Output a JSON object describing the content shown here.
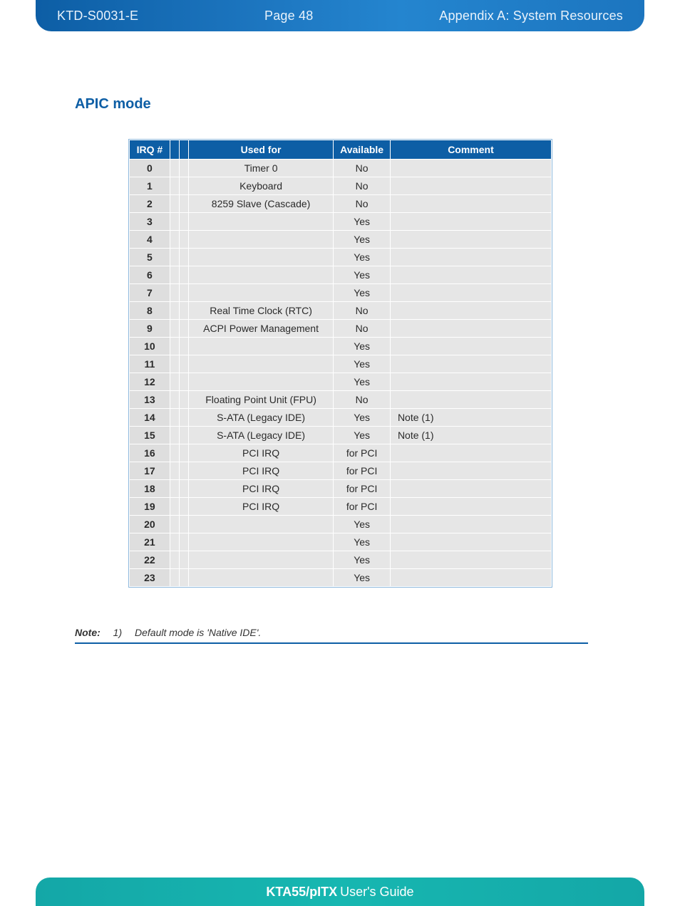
{
  "header": {
    "doc_id": "KTD-S0031-E",
    "page_label": "Page 48",
    "section": "Appendix A: System Resources"
  },
  "section_title": "APIC mode",
  "table": {
    "headers": {
      "irq": "IRQ #",
      "used_for": "Used for",
      "available": "Available",
      "comment": "Comment"
    },
    "rows": [
      {
        "irq": "0",
        "used_for": "Timer 0",
        "available": "No",
        "comment": ""
      },
      {
        "irq": "1",
        "used_for": "Keyboard",
        "available": "No",
        "comment": ""
      },
      {
        "irq": "2",
        "used_for": "8259 Slave (Cascade)",
        "available": "No",
        "comment": ""
      },
      {
        "irq": "3",
        "used_for": "",
        "available": "Yes",
        "comment": ""
      },
      {
        "irq": "4",
        "used_for": "",
        "available": "Yes",
        "comment": ""
      },
      {
        "irq": "5",
        "used_for": "",
        "available": "Yes",
        "comment": ""
      },
      {
        "irq": "6",
        "used_for": "",
        "available": "Yes",
        "comment": ""
      },
      {
        "irq": "7",
        "used_for": "",
        "available": "Yes",
        "comment": ""
      },
      {
        "irq": "8",
        "used_for": "Real Time Clock (RTC)",
        "available": "No",
        "comment": ""
      },
      {
        "irq": "9",
        "used_for": "ACPI Power Management",
        "available": "No",
        "comment": ""
      },
      {
        "irq": "10",
        "used_for": "",
        "available": "Yes",
        "comment": ""
      },
      {
        "irq": "11",
        "used_for": "",
        "available": "Yes",
        "comment": ""
      },
      {
        "irq": "12",
        "used_for": "",
        "available": "Yes",
        "comment": ""
      },
      {
        "irq": "13",
        "used_for": "Floating Point Unit (FPU)",
        "available": "No",
        "comment": ""
      },
      {
        "irq": "14",
        "used_for": "S-ATA (Legacy IDE)",
        "available": "Yes",
        "comment": "Note (1)"
      },
      {
        "irq": "15",
        "used_for": "S-ATA (Legacy IDE)",
        "available": "Yes",
        "comment": "Note (1)"
      },
      {
        "irq": "16",
        "used_for": "PCI IRQ",
        "available": "for PCI",
        "comment": ""
      },
      {
        "irq": "17",
        "used_for": "PCI IRQ",
        "available": "for PCI",
        "comment": ""
      },
      {
        "irq": "18",
        "used_for": "PCI IRQ",
        "available": "for PCI",
        "comment": ""
      },
      {
        "irq": "19",
        "used_for": "PCI IRQ",
        "available": "for PCI",
        "comment": ""
      },
      {
        "irq": "20",
        "used_for": "",
        "available": "Yes",
        "comment": ""
      },
      {
        "irq": "21",
        "used_for": "",
        "available": "Yes",
        "comment": ""
      },
      {
        "irq": "22",
        "used_for": "",
        "available": "Yes",
        "comment": ""
      },
      {
        "irq": "23",
        "used_for": "",
        "available": "Yes",
        "comment": ""
      }
    ]
  },
  "note": {
    "label": "Note:",
    "num": "1)",
    "text": "Default mode is 'Native IDE'."
  },
  "footer": {
    "product": "KTA55/pITX",
    "suffix": " User's Guide"
  }
}
